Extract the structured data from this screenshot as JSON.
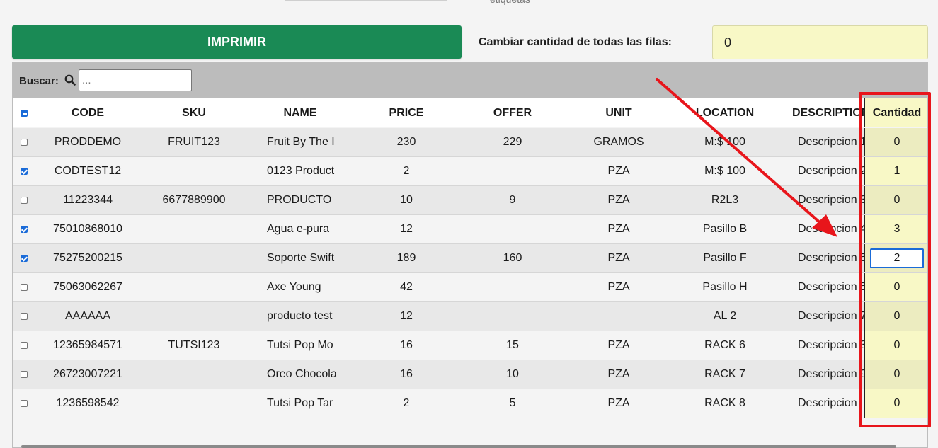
{
  "top_hint": "etiquetas",
  "toolbar": {
    "print_label": "IMPRIMIR",
    "bulk_label": "Cambiar cantidad de todas las filas:",
    "bulk_value": "0"
  },
  "search": {
    "label": "Buscar:",
    "placeholder": "..."
  },
  "columns": {
    "code": "CODE",
    "sku": "SKU",
    "name": "NAME",
    "price": "PRICE",
    "offer": "OFFER",
    "unit": "UNIT",
    "location": "LOCATION",
    "description": "DESCRIPTION",
    "cantidad": "Cantidad"
  },
  "rows": [
    {
      "checked": false,
      "code": "PRODDEMO",
      "sku": "FRUIT123",
      "name": "Fruit By The I",
      "price": "230",
      "offer": "229",
      "unit": "GRAMOS",
      "location": "M:$ 100",
      "description": "Descripcion 1",
      "cantidad": "0"
    },
    {
      "checked": true,
      "code": "CODTEST12",
      "sku": "",
      "name": "0123 Product",
      "price": "2",
      "offer": "",
      "unit": "PZA",
      "location": "M:$ 100",
      "description": "Descripcion 2",
      "cantidad": "1"
    },
    {
      "checked": false,
      "code": "11223344",
      "sku": "6677889900",
      "name": "PRODUCTO",
      "price": "10",
      "offer": "9",
      "unit": "PZA",
      "location": "R2L3",
      "description": "Descripcion 3",
      "cantidad": "0"
    },
    {
      "checked": true,
      "code": "75010868010",
      "sku": "",
      "name": "Agua e-pura",
      "price": "12",
      "offer": "",
      "unit": "PZA",
      "location": "Pasillo B",
      "description": "Descripcion 4",
      "cantidad": "3"
    },
    {
      "checked": true,
      "code": "75275200215",
      "sku": "",
      "name": "Soporte Swift",
      "price": "189",
      "offer": "160",
      "unit": "PZA",
      "location": "Pasillo F",
      "description": "Descripcion 5",
      "cantidad": "2"
    },
    {
      "checked": false,
      "code": "75063062267",
      "sku": "",
      "name": "Axe Young",
      "price": "42",
      "offer": "",
      "unit": "PZA",
      "location": "Pasillo H",
      "description": "Descripcion 5",
      "cantidad": "0"
    },
    {
      "checked": false,
      "code": "AAAAAA",
      "sku": "",
      "name": "producto test",
      "price": "12",
      "offer": "",
      "unit": "",
      "location": "AL 2",
      "description": "Descripcion 7",
      "cantidad": "0"
    },
    {
      "checked": false,
      "code": "12365984571",
      "sku": "TUTSI123",
      "name": "Tutsi Pop Mo",
      "price": "16",
      "offer": "15",
      "unit": "PZA",
      "location": "RACK 6",
      "description": "Descripcion 3",
      "cantidad": "0"
    },
    {
      "checked": false,
      "code": "26723007221",
      "sku": "",
      "name": "Oreo Chocola",
      "price": "16",
      "offer": "10",
      "unit": "PZA",
      "location": "RACK 7",
      "description": "Descripcion 9",
      "cantidad": "0"
    },
    {
      "checked": false,
      "code": "1236598542",
      "sku": "",
      "name": "Tutsi Pop Tar",
      "price": "2",
      "offer": "5",
      "unit": "PZA",
      "location": "RACK 8",
      "description": "Descripcion",
      "cantidad": "0"
    }
  ],
  "editing_row_index": 4,
  "colors": {
    "print_button": "#1a8a55",
    "cantidad_column": "#f8f8c6",
    "annotation": "#e8151b",
    "checkbox_accent": "#1a6bd8"
  }
}
